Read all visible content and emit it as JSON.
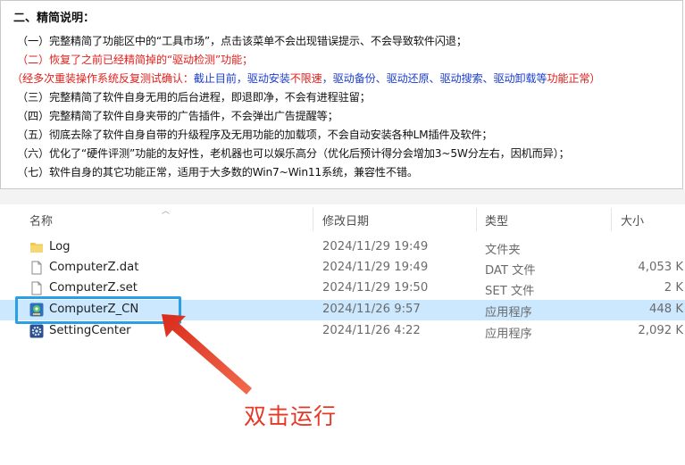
{
  "notes": {
    "heading": "二、精简说明：",
    "lines": [
      {
        "color": "black",
        "text": "（一）完整精简了功能区中的“工具市场”，点击该菜单不会出现错误提示、不会导致软件闪退；"
      },
      {
        "color": "red",
        "text": "（二）恢复了之前已经精简掉的“驱动检测”功能；"
      },
      {
        "color": "mixed",
        "parts": [
          {
            "color": "red",
            "text": "（经多次重装操作系统反复测试确认："
          },
          {
            "color": "blue",
            "text": "截止目前，驱动安装"
          },
          {
            "color": "red",
            "text": "不限速"
          },
          {
            "color": "blue",
            "text": "，驱动备份、驱动还原、驱动搜索、驱动卸载等"
          },
          {
            "color": "red",
            "text": "功能正常）"
          }
        ]
      },
      {
        "color": "black",
        "text": "（三）完整精简了软件自身无用的后台进程，即退即净，不会有进程驻留；"
      },
      {
        "color": "black",
        "text": "（四）完整精简了软件自身夹带的广告插件，不会弹出广告提醒等；"
      },
      {
        "color": "black",
        "text": "（五）彻底去除了软件自身自带的升级程序及无用功能的加载项，不会自动安装各种LM插件及软件；"
      },
      {
        "color": "black",
        "text": "（六）优化了“硬件评测”功能的友好性，老机器也可以娱乐高分（优化后预计得分会增加3~5W分左右，因机而异）；"
      },
      {
        "color": "black",
        "text": "（七）软件自身的其它功能正常，适用于大多数的Win7~Win11系统，兼容性不错。"
      }
    ]
  },
  "columns": {
    "name": "名称",
    "date": "修改日期",
    "type": "类型",
    "size": "大小"
  },
  "files": [
    {
      "icon": "folder-icon",
      "name": "Log",
      "date": "2024/11/29 19:49",
      "type": "文件夹",
      "size": ""
    },
    {
      "icon": "document-icon",
      "name": "ComputerZ.dat",
      "date": "2024/11/29 19:49",
      "type": "DAT 文件",
      "size": "4,053 K"
    },
    {
      "icon": "document-icon",
      "name": "ComputerZ.set",
      "date": "2024/11/29 19:50",
      "type": "SET 文件",
      "size": "2 K"
    },
    {
      "icon": "app-icon",
      "name": "ComputerZ_CN",
      "date": "2024/11/26 9:57",
      "type": "应用程序",
      "size": "448 K"
    },
    {
      "icon": "gear-icon",
      "name": "SettingCenter",
      "date": "2024/11/26 4:22",
      "type": "应用程序",
      "size": "2,092 K"
    }
  ],
  "selected_row": 3,
  "annotation": {
    "label": "双击运行"
  },
  "colors": {
    "red": "#e0211d",
    "blue": "#1d3fc9",
    "selection": "#cce8ff",
    "highlight": "#2b9fe6",
    "annotation": "#e53826"
  }
}
